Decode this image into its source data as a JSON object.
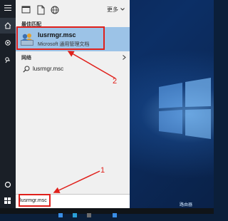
{
  "top_bar": {
    "more_label": "更多"
  },
  "best_match": {
    "section_label": "最佳匹配",
    "title": "lusrmgr.msc",
    "subtitle": "Microsoft 通用管理文档"
  },
  "web": {
    "section_label": "网络",
    "item_label": "lusrmgr.msc"
  },
  "search_box": {
    "value": "lusrmgr.msc"
  },
  "annotations": {
    "step1": "1",
    "step2": "2",
    "color": "#e0201b"
  },
  "watermark": {
    "text": "路由器"
  },
  "colors": {
    "panel_bg": "#f0f0f0",
    "highlight_bg": "#9cc3e7",
    "rail_bg": "#1a1f27"
  }
}
